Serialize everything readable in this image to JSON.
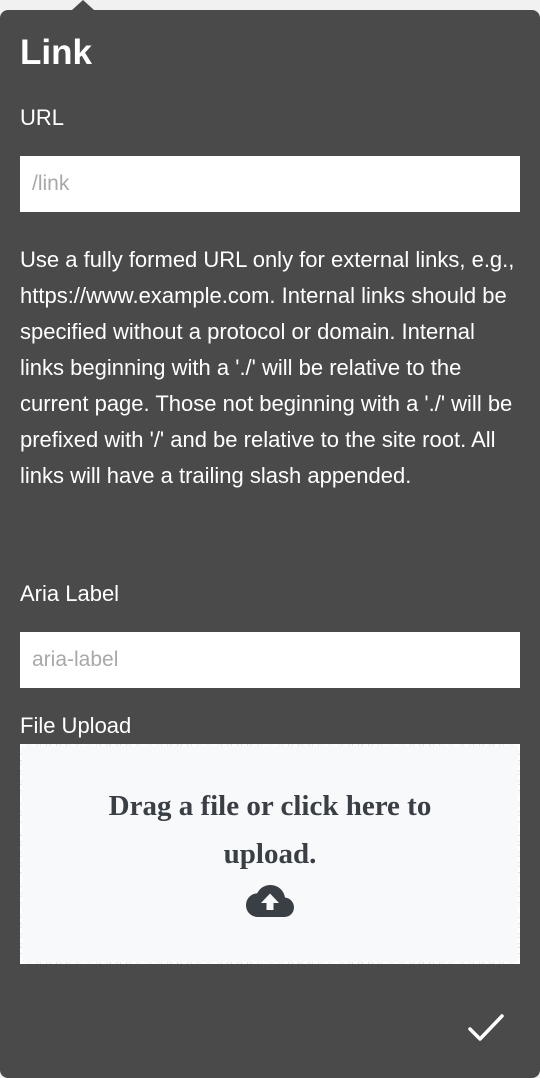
{
  "dialog": {
    "title": "Link",
    "url_label": "URL",
    "url_placeholder": "/link",
    "url_value": "",
    "help_text": "Use a fully formed URL only for external links, e.g., https://www.example.com. Internal links should be specified without a protocol or domain. Internal links beginning with a './' will be relative to the current page. Those not beginning with a './' will be prefixed with '/' and be relative to the site root. All links will have a trailing slash appended.",
    "aria_label": "Aria Label",
    "aria_placeholder": "aria-label",
    "aria_value": "",
    "upload_label": "File Upload",
    "upload_text": "Drag a file or click here to upload.",
    "upload_icon": "cloud-upload-icon",
    "confirm_icon": "checkmark-icon"
  },
  "colors": {
    "panel_bg": "#4a4a4a",
    "dropzone_bg": "#f8f9fb",
    "dropzone_text": "#3a3f45"
  }
}
